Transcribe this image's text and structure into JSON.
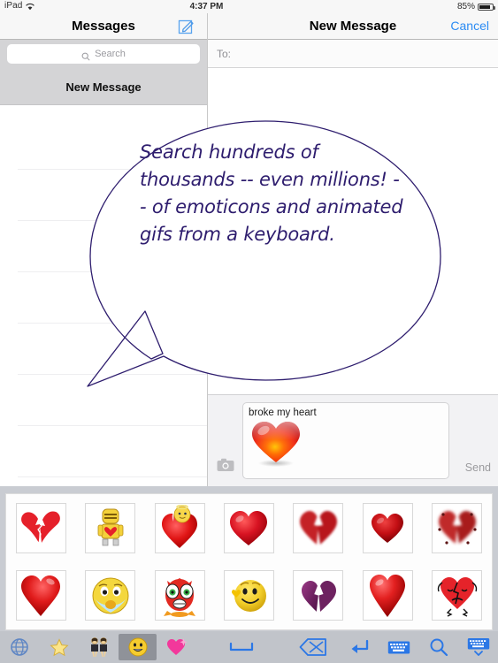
{
  "status_bar": {
    "device": "iPad",
    "wifi_icon": "wifi-icon",
    "time": "4:37 PM",
    "battery_percent": "85%",
    "battery_icon": "battery-icon"
  },
  "sidebar": {
    "title": "Messages",
    "compose_icon": "compose-icon",
    "search": {
      "placeholder": "Search",
      "icon": "search-icon"
    },
    "selected_row": "New Message",
    "conversation_rows": 7
  },
  "right_pane": {
    "title": "New Message",
    "cancel_label": "Cancel",
    "to_label": "To:"
  },
  "compose_bar": {
    "camera_icon": "camera-icon",
    "message_text": "broke my heart",
    "attachment_icon": "red-heart-emoji",
    "send_label": "Send"
  },
  "callout": {
    "text": "Search hundreds of thousands -- even millions! -- of emoticons and animated gifs from a keyboard.",
    "color": "#2e1d6e"
  },
  "keyboard": {
    "emoji_rows": [
      [
        {
          "name": "broken-heart-halves-emoji"
        },
        {
          "name": "yellow-robot-holding-heart-emoji"
        },
        {
          "name": "angel-smiley-on-heart-emoji"
        },
        {
          "name": "red-heart-emoji"
        },
        {
          "name": "fuzzy-broken-heart-emoji"
        },
        {
          "name": "glossy-red-heart-emoji"
        },
        {
          "name": "broken-heart-with-dots-emoji"
        }
      ],
      [
        {
          "name": "large-red-heart-emoji"
        },
        {
          "name": "crying-blue-smiley-emoji"
        },
        {
          "name": "shocked-red-face-emoji"
        },
        {
          "name": "yellow-smiley-blowing-heart-emoji"
        },
        {
          "name": "purple-broken-heart-emoji"
        },
        {
          "name": "tall-red-heart-emoji"
        },
        {
          "name": "sad-heart-character-emoji"
        }
      ]
    ],
    "toolbar": [
      {
        "name": "globe-icon",
        "glyph": "globe",
        "selected": false
      },
      {
        "name": "favorites-star-icon",
        "glyph": "star",
        "selected": false
      },
      {
        "name": "people-icon",
        "glyph": "people",
        "selected": false
      },
      {
        "name": "smiley-icon",
        "glyph": "smiley",
        "selected": true
      },
      {
        "name": "sparkle-heart-icon",
        "glyph": "sparkheart",
        "selected": false
      },
      {
        "name": "space-key",
        "glyph": "space",
        "selected": false
      },
      {
        "name": "delete-key",
        "glyph": "delete",
        "selected": false
      },
      {
        "name": "return-key",
        "glyph": "return",
        "selected": false
      },
      {
        "name": "keyboard-switch-icon",
        "glyph": "keyboard",
        "selected": false
      },
      {
        "name": "search-icon",
        "glyph": "search",
        "selected": false
      },
      {
        "name": "hide-keyboard-icon",
        "glyph": "hidekb",
        "selected": false
      }
    ]
  },
  "colors": {
    "accent_blue": "#2b8bf3",
    "keyboard_bg": "#c9ccd2",
    "toolbar_bg": "#c1c4ca",
    "callout_ink": "#2e1d6e"
  }
}
